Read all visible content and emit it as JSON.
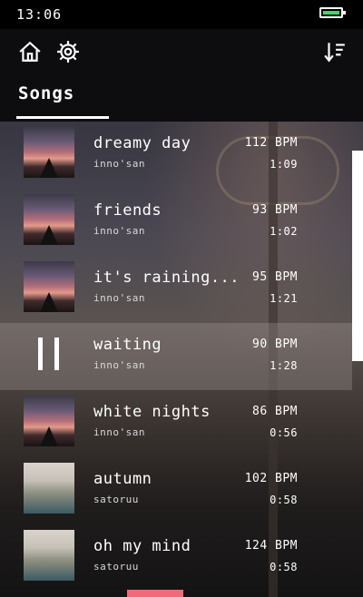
{
  "status_bar": {
    "time": "13:06"
  },
  "toolbar": {
    "home_icon": "home-icon",
    "settings_icon": "gear-icon",
    "sort_icon": "sort-icon"
  },
  "tabs": {
    "songs": "Songs"
  },
  "songs": [
    {
      "title": "dreamy day",
      "artist": "inno'san",
      "bpm": "112 BPM",
      "duration": "1:09",
      "thumb": "sunset",
      "playing": false
    },
    {
      "title": "friends",
      "artist": "inno'san",
      "bpm": "93 BPM",
      "duration": "1:02",
      "thumb": "sunset",
      "playing": false
    },
    {
      "title": "it's raining...",
      "artist": "inno'san",
      "bpm": "95 BPM",
      "duration": "1:21",
      "thumb": "sunset",
      "playing": false
    },
    {
      "title": "waiting",
      "artist": "inno'san",
      "bpm": "90 BPM",
      "duration": "1:28",
      "thumb": "sunset",
      "playing": true
    },
    {
      "title": "white nights",
      "artist": "inno'san",
      "bpm": "86 BPM",
      "duration": "0:56",
      "thumb": "sunset",
      "playing": false
    },
    {
      "title": "autumn",
      "artist": "satoruu",
      "bpm": "102 BPM",
      "duration": "0:58",
      "thumb": "photo",
      "playing": false
    },
    {
      "title": "oh my mind",
      "artist": "satoruu",
      "bpm": "124 BPM",
      "duration": "0:58",
      "thumb": "photo",
      "playing": false
    }
  ],
  "colors": {
    "battery": "#3fd66b",
    "accent": "#f06a7a",
    "active_row": "#a09696"
  }
}
